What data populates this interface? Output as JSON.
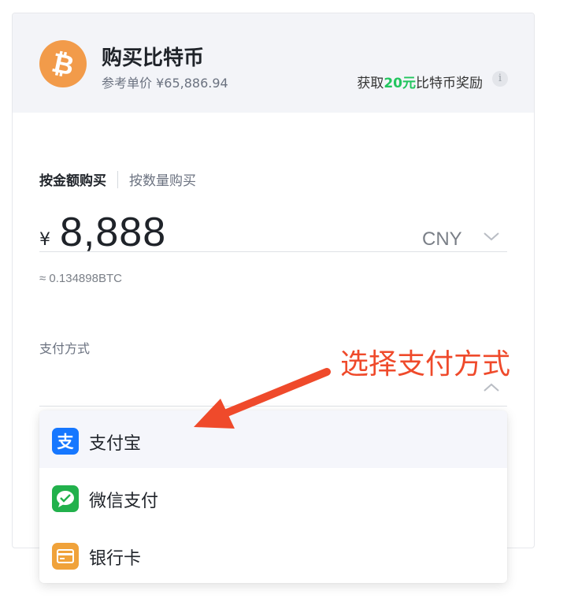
{
  "header": {
    "title": "购买比特币",
    "ref_price": "参考单价 ¥65,886.94",
    "reward_prefix": "获取",
    "reward_amount": "20元",
    "reward_suffix": "比特币奖励",
    "info_glyph": "i",
    "logo_icon": "bitcoin-icon"
  },
  "tabs": {
    "by_amount": "按金额购买",
    "by_quantity": "按数量购买"
  },
  "amount": {
    "symbol": "¥",
    "value": "8,888",
    "currency": "CNY",
    "btc_equivalent": "≈ 0.134898BTC"
  },
  "payment": {
    "label": "支付方式",
    "options": [
      {
        "label": "支付宝",
        "icon": "alipay-icon",
        "color": "#1677ff"
      },
      {
        "label": "微信支付",
        "icon": "wechat-pay-icon",
        "color": "#22b14c"
      },
      {
        "label": "银行卡",
        "icon": "bank-card-icon",
        "color": "#f0a23a"
      }
    ]
  },
  "annotation": {
    "text": "选择支付方式",
    "color": "#ef4a2b"
  },
  "colors": {
    "accent_green": "#22c55e",
    "bitcoin_orange": "#f29b4a"
  }
}
